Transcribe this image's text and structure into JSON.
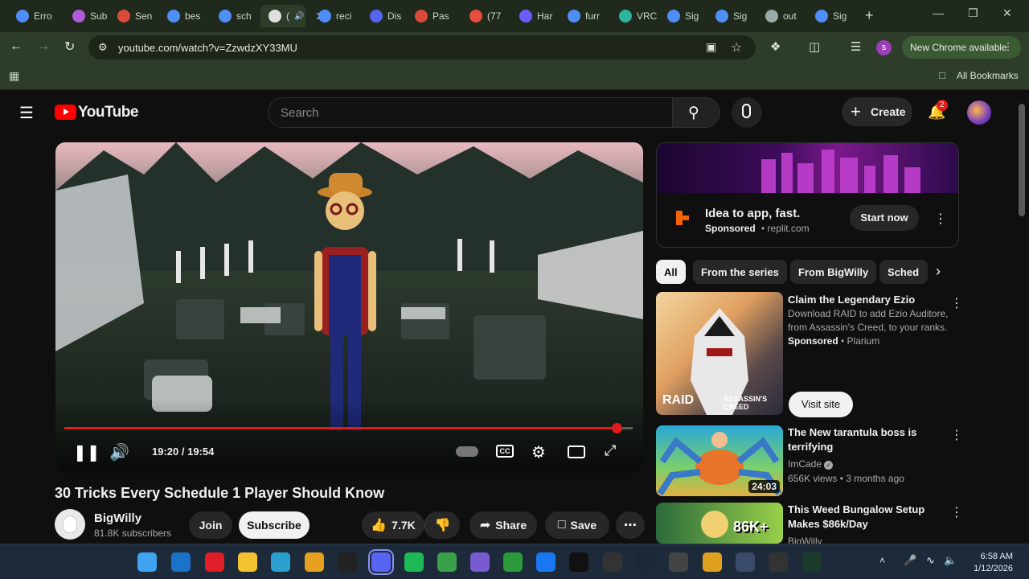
{
  "browser": {
    "tabs": [
      {
        "label": "Erro",
        "color": "#4f8df7"
      },
      {
        "label": "Sub",
        "color": "#b05cd8"
      },
      {
        "label": "Sen",
        "color": "#d94a3a"
      },
      {
        "label": "bes",
        "color": "#4f8df7"
      },
      {
        "label": "sch",
        "color": "#4f8df7"
      },
      {
        "label": "(",
        "color": "#e0e0e0"
      },
      {
        "label": "reci",
        "color": "#4f8df7"
      },
      {
        "label": "Dis",
        "color": "#5865f2"
      },
      {
        "label": "Pas",
        "color": "#d94a3a"
      },
      {
        "label": "(77",
        "color": "#e74c3c"
      },
      {
        "label": "Har",
        "color": "#6a5cff"
      },
      {
        "label": "furr",
        "color": "#4f8df7"
      },
      {
        "label": "VRC",
        "color": "#2bb3a0"
      },
      {
        "label": "Sig",
        "color": "#4f8df7"
      },
      {
        "label": "Sig",
        "color": "#4f8df7"
      },
      {
        "label": "out",
        "color": "#9aa"
      },
      {
        "label": "Sig",
        "color": "#4f8df7"
      }
    ],
    "url": "youtube.com/watch?v=ZzwdzXY33MU",
    "profile_initial": "s",
    "update_label": "New Chrome available",
    "bookmarks_label": "All Bookmarks"
  },
  "youtube": {
    "logo_text": "YouTube",
    "search_placeholder": "Search",
    "create_label": "Create",
    "notif_count": "2"
  },
  "video": {
    "title": "30 Tricks Every Schedule 1 Player Should Know",
    "timecode": "19:20 / 19:54",
    "progress": 0.972,
    "channel_name": "BigWilly",
    "subscribers": "81.8K subscribers",
    "join_label": "Join",
    "subscribe_label": "Subscribe",
    "likes": "7.7K",
    "share_label": "Share",
    "save_label": "Save"
  },
  "ad": {
    "title": "Idea to app, fast.",
    "sponsored": "Sponsored",
    "domain": "replit.com",
    "cta": "Start now"
  },
  "chips": [
    "All",
    "From the series",
    "From BigWilly",
    "Sched"
  ],
  "recommendations": [
    {
      "title": "Claim the Legendary Ezio",
      "desc": "Download RAID to add Ezio Auditore, from Assassin's Creed, to your ranks.",
      "sponsored": "Sponsored",
      "advertiser": "Plarium",
      "cta": "Visit site",
      "thumb_text_left": "RAID",
      "thumb_text_right": "ASSASSIN'S CREED"
    },
    {
      "title": "The New tarantula boss is terrifying",
      "channel": "ImCade",
      "meta": "656K views • 3 months ago",
      "duration": "24:03"
    },
    {
      "title": "This Weed Bungalow Setup Makes $86k/Day",
      "channel": "BigWilly",
      "thumb_text": "86K+"
    }
  ],
  "taskbar": {
    "time": "6:58 AM",
    "date": "1/12/2026"
  }
}
